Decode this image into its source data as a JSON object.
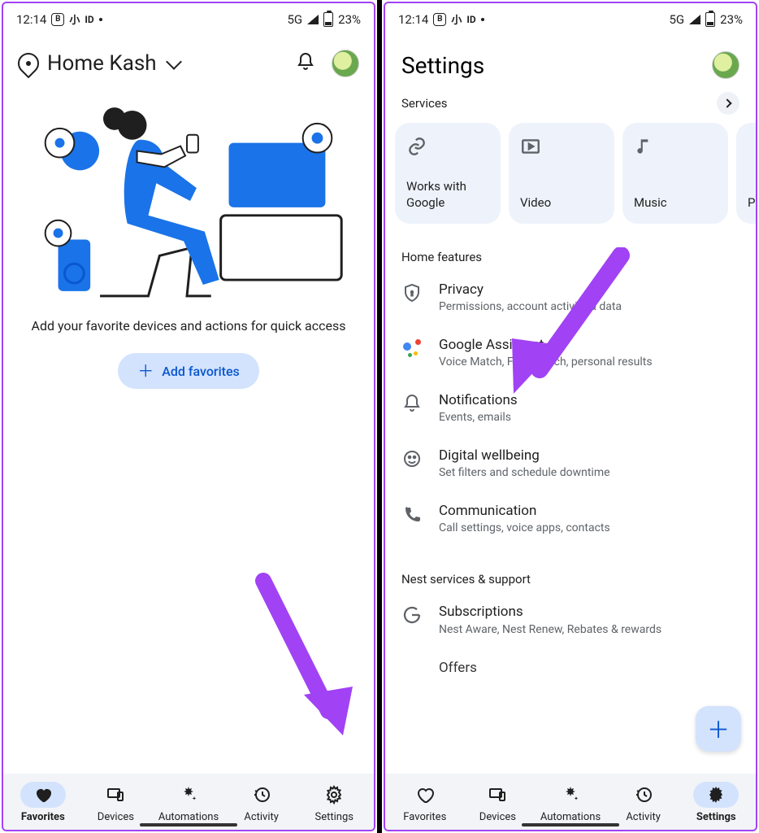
{
  "status": {
    "time": "12:14",
    "network": "5G",
    "battery": "23%"
  },
  "screen1": {
    "home_name": "Home Kash",
    "fav_text": "Add your favorite devices and actions for quick access",
    "add_button": "Add favorites",
    "nav": [
      "Favorites",
      "Devices",
      "Automations",
      "Activity",
      "Settings"
    ]
  },
  "screen2": {
    "title": "Settings",
    "services_label": "Services",
    "service_cards": [
      {
        "label": "Works with Google"
      },
      {
        "label": "Video"
      },
      {
        "label": "Music"
      },
      {
        "label": "P"
      }
    ],
    "home_features_label": "Home features",
    "features": [
      {
        "title": "Privacy",
        "sub": "Permissions, account activity & data"
      },
      {
        "title": "Google Assistant",
        "sub": "Voice Match, Face Match, personal results"
      },
      {
        "title": "Notifications",
        "sub": "Events, emails"
      },
      {
        "title": "Digital wellbeing",
        "sub": "Set filters and schedule downtime"
      },
      {
        "title": "Communication",
        "sub": "Call settings, voice apps, contacts"
      }
    ],
    "nest_label": "Nest services & support",
    "nest": [
      {
        "title": "Subscriptions",
        "sub": "Nest Aware, Nest Renew, Rebates & rewards"
      },
      {
        "title": "Offers",
        "sub": ""
      }
    ],
    "nav": [
      "Favorites",
      "Devices",
      "Automations",
      "Activity",
      "Settings"
    ]
  }
}
